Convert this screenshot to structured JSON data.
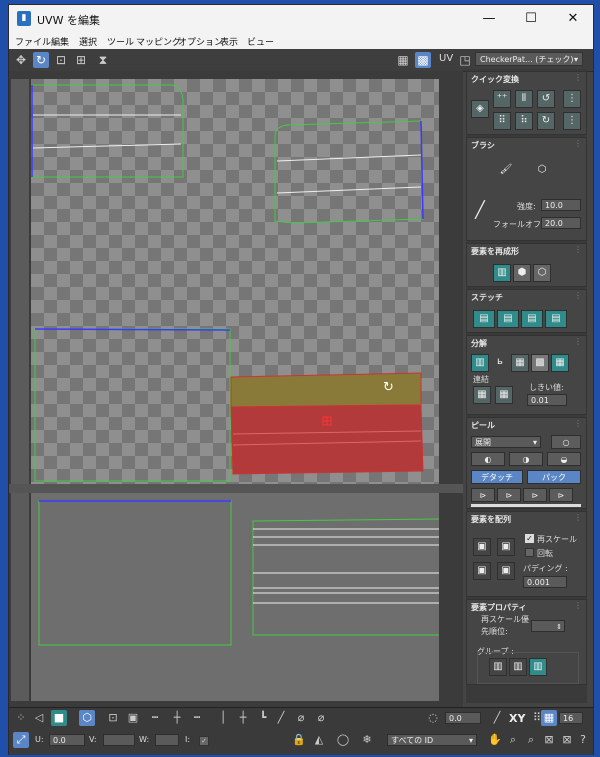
{
  "window": {
    "title": "UVW を編集",
    "minimize": "—",
    "maximize": "☐",
    "close": "✕"
  },
  "menubar": [
    "ファイル",
    "編集",
    "選択",
    "ツール",
    "マッピング",
    "オプション",
    "表示",
    "ビュー"
  ],
  "toolbar": {
    "uv_label": "UV",
    "texture_select": "CheckerPat... (チェック)",
    "texture_arrow": "▾"
  },
  "panel": {
    "quick": {
      "title": "クイック変換"
    },
    "brush": {
      "title": "ブラシ",
      "strength_label": "強度:",
      "strength": "10.0",
      "falloff_label": "フォールオフ:",
      "falloff": "20.0"
    },
    "reshape": {
      "title": "要素を再成形"
    },
    "stitch": {
      "title": "ステッチ"
    },
    "explode": {
      "title": "分解",
      "weld_label": "連結",
      "threshold_label": "しきい値:",
      "threshold": "0.01"
    },
    "peel": {
      "title": "ピール",
      "mode": "展開",
      "detach": "デタッチ",
      "pack": "パック"
    },
    "arrange": {
      "title": "要素を配列",
      "rescale": "再スケール",
      "rotate": "回転",
      "padding_label": "パディング :",
      "padding": "0.001"
    },
    "props": {
      "title": "要素プロパティ",
      "priority_label1": "再スケール優",
      "priority_label2": "先順位:",
      "group_label": "グループ :"
    }
  },
  "bottom": {
    "angle": "0.0",
    "xy": "XY",
    "grid": "16",
    "u_label": "U:",
    "u_value": "0.0",
    "v_label": "V:",
    "w_label": "W:",
    "i_label": "I:",
    "id_select": "すべての ID"
  },
  "colors": {
    "selected_fill": "#b33a3a",
    "peel_fill": "#8a7a3a",
    "uv_edge": "#47c847",
    "seam": "#3a3aff"
  }
}
